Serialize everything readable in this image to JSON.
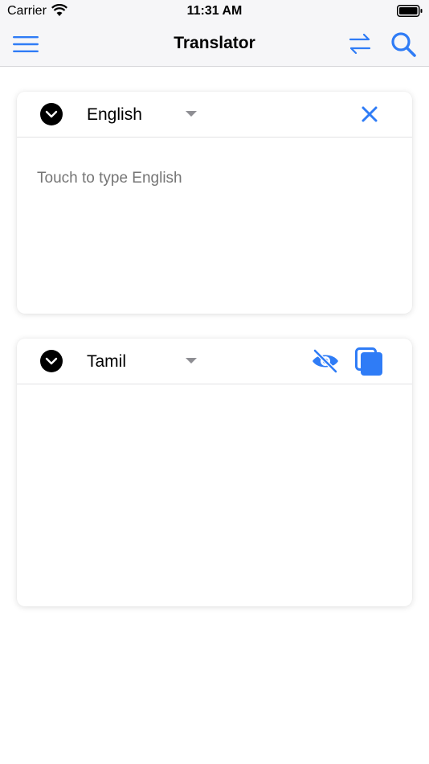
{
  "status_bar": {
    "carrier": "Carrier",
    "time": "11:31 AM"
  },
  "nav": {
    "title": "Translator",
    "left_icon": "hamburger-menu-icon",
    "right_icons": [
      "swap-arrows-icon",
      "search-icon"
    ]
  },
  "source": {
    "language": "English",
    "placeholder": "Touch to type English",
    "action_icon": "close-icon"
  },
  "target": {
    "language": "Tamil",
    "action_icons": [
      "eye-off-icon",
      "copy-icon"
    ]
  },
  "colors": {
    "accent": "#2f7cf6",
    "bar_background": "#f6f6f8",
    "placeholder": "#b3b3b8"
  }
}
